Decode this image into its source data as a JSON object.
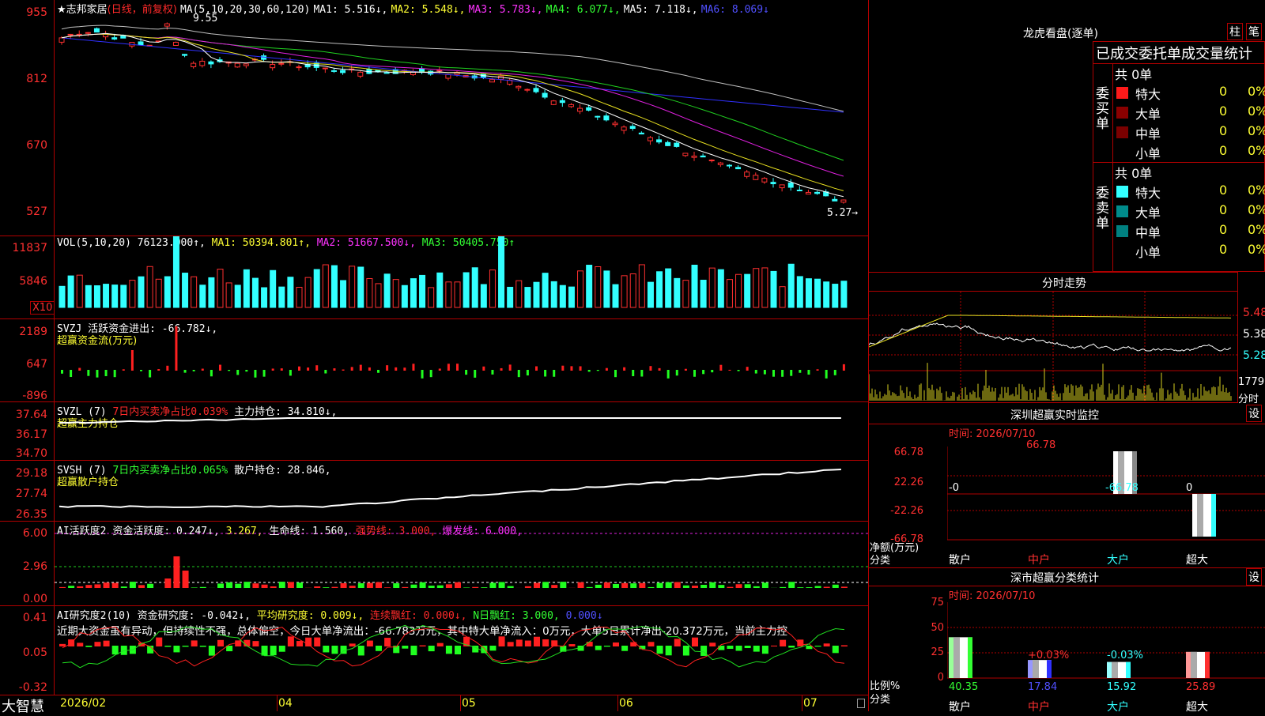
{
  "chart": {
    "title": "★志邦家居",
    "subtitle": "(日线，前复权)",
    "ma_label": "MA(5,10,20,30,60,120)",
    "ma1": "MA1: 5.516↓,",
    "ma2": "MA2: 5.548↓,",
    "ma3": "MA3: 5.783↓,",
    "ma4": "MA4: 6.077↓,",
    "ma5": "MA5: 7.118↓,",
    "ma6": "MA6: 8.069↓",
    "high_note": "9.55",
    "low_note": "5.27→",
    "y_ticks": [
      "955",
      "812",
      "670",
      "527"
    ]
  },
  "vol": {
    "label": "VOL(5,10,20)",
    "value": "76123.000↑,",
    "ma1": "MA1: 50394.801↑,",
    "ma2": "MA2: 51667.500↓,",
    "ma3": "MA3: 50405.750↑",
    "y_ticks": [
      "11837",
      "5846"
    ],
    "unit": "X10"
  },
  "svzj": {
    "label": "SVZJ  活跃资金进出: -66.782↓,",
    "sub": "超赢资金流(万元)",
    "y_ticks": [
      "2189",
      "647",
      "-896"
    ]
  },
  "svzl": {
    "label": "SVZL (7)",
    "ratio": "7日内买卖净占比0.039%",
    "hold": "主力持仓: 34.810↓,",
    "sub": "超赢主力持仓",
    "y_ticks": [
      "37.64",
      "36.17",
      "34.70"
    ]
  },
  "svsh": {
    "label": "SVSH (7)",
    "ratio": "7日内买卖净占比0.065%",
    "hold": "散户持仓: 28.846,",
    "sub": "超赢散户持仓",
    "y_ticks": [
      "29.18",
      "27.74",
      "26.35"
    ]
  },
  "ai1": {
    "label": "AI活跃度2",
    "v1": "资金活跃度: 0.247↓,",
    "v2": "3.267,",
    "v3": "生命线: 1.560,",
    "v4": "强势线: 3.000,",
    "v5": "爆发线: 6.000,",
    "y_ticks": [
      "6.00",
      "2.96",
      "0.00"
    ]
  },
  "ai2": {
    "label": "AI研究度2(10)",
    "v1": "资金研究度: -0.042↓,",
    "v2": "平均研究度: 0.009↓,",
    "v3": "连续飘红: 0.000↓,",
    "v4": "N日飘红: 3.000,",
    "v5": "0.000↓",
    "desc": "近期大资金虽有异动，但持续性不强，总体偏空，今日大单净流出：-66.783万元，其中特大单净流入：0万元，大单5日累计净出-20.372万元，当前主力控",
    "y_ticks": [
      "0.41",
      "0.05",
      "-0.32"
    ]
  },
  "bottom": {
    "brand": "大智慧",
    "dates": [
      "2026/02",
      "04",
      "05",
      "06",
      "07"
    ]
  },
  "right": {
    "lhb_title": "龙虎看盘(逐单)",
    "btn1": "柱",
    "btn2": "笔",
    "stats_title": "已成交委托单成交量统计",
    "buy_label": "委买单",
    "sell_label": "委卖单",
    "buy_total": "共 0单",
    "sell_total": "共 0单",
    "rows": [
      {
        "name": "特大",
        "count": "0",
        "pct": "0%"
      },
      {
        "name": "大单",
        "count": "0",
        "pct": "0%"
      },
      {
        "name": "中单",
        "count": "0",
        "pct": "0%"
      },
      {
        "name": "小单",
        "count": "0",
        "pct": "0%"
      }
    ],
    "buy_colors": [
      "#ff1a1a",
      "#8a0000",
      "#7a0000",
      "#000000"
    ],
    "sell_colors": [
      "#33ffff",
      "#008b8b",
      "#008080",
      "#000000"
    ],
    "fenshi_title": "分时走势",
    "fenshi_ticks": [
      "5.48",
      "5.38",
      "5.28"
    ],
    "fenshi_vol": "1779",
    "fenshi_vol_unit": "分时",
    "monitor_title": "深圳超赢实时监控",
    "set_btn": "设",
    "monitor_time": "时间: 2026/07/10",
    "monitor_ticks": [
      "66.78",
      "22.26",
      "-22.26",
      "-66.78"
    ],
    "monitor_vals": [
      "-0",
      "66.78",
      "-66.78",
      "0"
    ],
    "monitor_unit": "净额(万元)",
    "monitor_cat": "分类",
    "cats": [
      "散户",
      "中户",
      "大户",
      "超大"
    ],
    "cls_title": "深市超赢分类统计",
    "cls_time": "时间: 2026/07/10",
    "cls_ticks": [
      "75",
      "50",
      "25",
      "0"
    ],
    "cls_top": [
      "",
      "+0.03%",
      "-0.03%",
      ""
    ],
    "cls_vals": [
      "40.35",
      "17.84",
      "15.92",
      "25.89"
    ],
    "cls_unit": "比例%",
    "cls_cat": "分类"
  }
}
